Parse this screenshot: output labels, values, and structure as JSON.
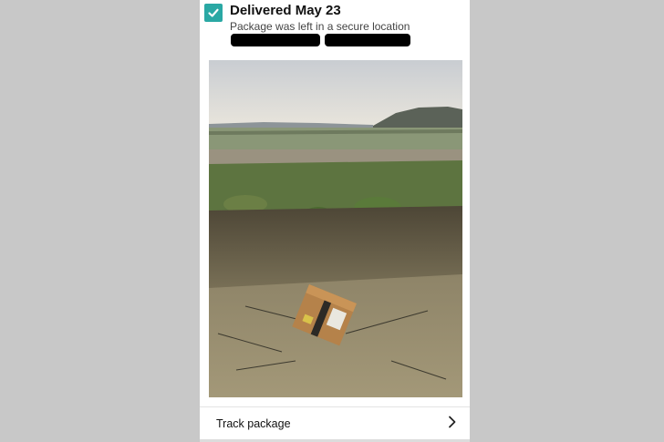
{
  "delivery": {
    "status_title": "Delivered May 23",
    "status_detail": "Package was left in a secure location",
    "check_color": "#2aa8a4"
  },
  "icons": {
    "status": "checkmark-icon",
    "track_chevron": "chevron-right-icon"
  },
  "actions": {
    "track_label": "Track package"
  }
}
